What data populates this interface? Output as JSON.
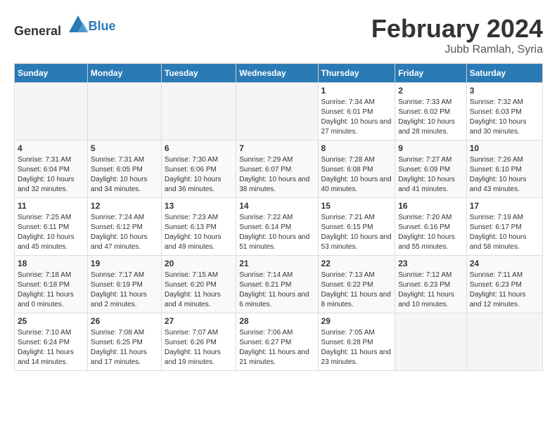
{
  "header": {
    "logo_general": "General",
    "logo_blue": "Blue",
    "main_title": "February 2024",
    "subtitle": "Jubb Ramlah, Syria"
  },
  "weekdays": [
    "Sunday",
    "Monday",
    "Tuesday",
    "Wednesday",
    "Thursday",
    "Friday",
    "Saturday"
  ],
  "weeks": [
    [
      {
        "day": "",
        "empty": true
      },
      {
        "day": "",
        "empty": true
      },
      {
        "day": "",
        "empty": true
      },
      {
        "day": "",
        "empty": true
      },
      {
        "day": "1",
        "sunrise": "7:34 AM",
        "sunset": "6:01 PM",
        "daylight": "10 hours and 27 minutes."
      },
      {
        "day": "2",
        "sunrise": "7:33 AM",
        "sunset": "6:02 PM",
        "daylight": "10 hours and 28 minutes."
      },
      {
        "day": "3",
        "sunrise": "7:32 AM",
        "sunset": "6:03 PM",
        "daylight": "10 hours and 30 minutes."
      }
    ],
    [
      {
        "day": "4",
        "sunrise": "7:31 AM",
        "sunset": "6:04 PM",
        "daylight": "10 hours and 32 minutes."
      },
      {
        "day": "5",
        "sunrise": "7:31 AM",
        "sunset": "6:05 PM",
        "daylight": "10 hours and 34 minutes."
      },
      {
        "day": "6",
        "sunrise": "7:30 AM",
        "sunset": "6:06 PM",
        "daylight": "10 hours and 36 minutes."
      },
      {
        "day": "7",
        "sunrise": "7:29 AM",
        "sunset": "6:07 PM",
        "daylight": "10 hours and 38 minutes."
      },
      {
        "day": "8",
        "sunrise": "7:28 AM",
        "sunset": "6:08 PM",
        "daylight": "10 hours and 40 minutes."
      },
      {
        "day": "9",
        "sunrise": "7:27 AM",
        "sunset": "6:09 PM",
        "daylight": "10 hours and 41 minutes."
      },
      {
        "day": "10",
        "sunrise": "7:26 AM",
        "sunset": "6:10 PM",
        "daylight": "10 hours and 43 minutes."
      }
    ],
    [
      {
        "day": "11",
        "sunrise": "7:25 AM",
        "sunset": "6:11 PM",
        "daylight": "10 hours and 45 minutes."
      },
      {
        "day": "12",
        "sunrise": "7:24 AM",
        "sunset": "6:12 PM",
        "daylight": "10 hours and 47 minutes."
      },
      {
        "day": "13",
        "sunrise": "7:23 AM",
        "sunset": "6:13 PM",
        "daylight": "10 hours and 49 minutes."
      },
      {
        "day": "14",
        "sunrise": "7:22 AM",
        "sunset": "6:14 PM",
        "daylight": "10 hours and 51 minutes."
      },
      {
        "day": "15",
        "sunrise": "7:21 AM",
        "sunset": "6:15 PM",
        "daylight": "10 hours and 53 minutes."
      },
      {
        "day": "16",
        "sunrise": "7:20 AM",
        "sunset": "6:16 PM",
        "daylight": "10 hours and 55 minutes."
      },
      {
        "day": "17",
        "sunrise": "7:19 AM",
        "sunset": "6:17 PM",
        "daylight": "10 hours and 58 minutes."
      }
    ],
    [
      {
        "day": "18",
        "sunrise": "7:18 AM",
        "sunset": "6:18 PM",
        "daylight": "11 hours and 0 minutes."
      },
      {
        "day": "19",
        "sunrise": "7:17 AM",
        "sunset": "6:19 PM",
        "daylight": "11 hours and 2 minutes."
      },
      {
        "day": "20",
        "sunrise": "7:15 AM",
        "sunset": "6:20 PM",
        "daylight": "11 hours and 4 minutes."
      },
      {
        "day": "21",
        "sunrise": "7:14 AM",
        "sunset": "6:21 PM",
        "daylight": "11 hours and 6 minutes."
      },
      {
        "day": "22",
        "sunrise": "7:13 AM",
        "sunset": "6:22 PM",
        "daylight": "11 hours and 8 minutes."
      },
      {
        "day": "23",
        "sunrise": "7:12 AM",
        "sunset": "6:23 PM",
        "daylight": "11 hours and 10 minutes."
      },
      {
        "day": "24",
        "sunrise": "7:11 AM",
        "sunset": "6:23 PM",
        "daylight": "11 hours and 12 minutes."
      }
    ],
    [
      {
        "day": "25",
        "sunrise": "7:10 AM",
        "sunset": "6:24 PM",
        "daylight": "11 hours and 14 minutes."
      },
      {
        "day": "26",
        "sunrise": "7:08 AM",
        "sunset": "6:25 PM",
        "daylight": "11 hours and 17 minutes."
      },
      {
        "day": "27",
        "sunrise": "7:07 AM",
        "sunset": "6:26 PM",
        "daylight": "11 hours and 19 minutes."
      },
      {
        "day": "28",
        "sunrise": "7:06 AM",
        "sunset": "6:27 PM",
        "daylight": "11 hours and 21 minutes."
      },
      {
        "day": "29",
        "sunrise": "7:05 AM",
        "sunset": "6:28 PM",
        "daylight": "11 hours and 23 minutes."
      },
      {
        "day": "",
        "empty": true
      },
      {
        "day": "",
        "empty": true
      }
    ]
  ]
}
